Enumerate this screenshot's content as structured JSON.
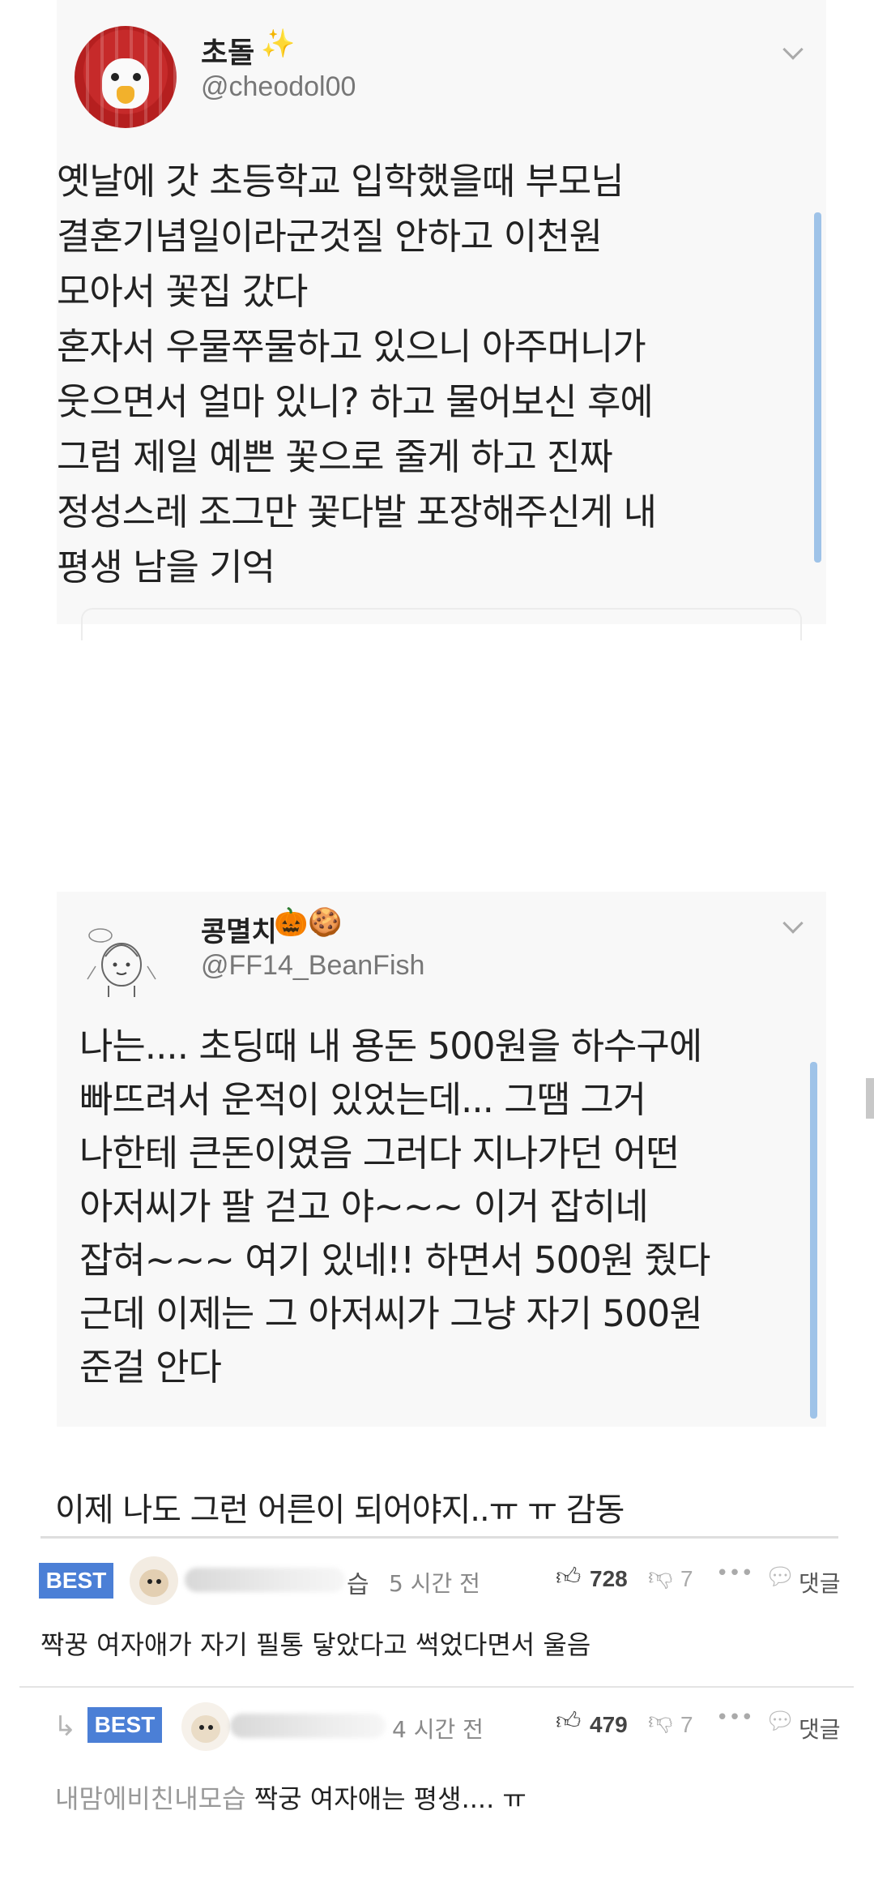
{
  "tweets": [
    {
      "name": "초돌",
      "emoji": "✨",
      "handle": "@cheodol00",
      "text": "옛날에 갓 초등학교 입학했을때 부모님\n결혼기념일이라군것질 안하고 이천원\n모아서 꽃집 갔다\n혼자서 우물쭈물하고 있으니 아주머니가\n웃으면서 얼마 있니? 하고 물어보신 후에\n그럼 제일 예쁜 꽃으로 줄게 하고 진짜\n정성스레 조그만 꽃다발 포장해주신게 내\n평생 남을 기억"
    },
    {
      "name": "콩멸치",
      "emoji": "🎃🍪",
      "handle": "@FF14_BeanFish",
      "text": "나는.... 초딩때 내 용돈 500원을 하수구에\n빠뜨려서 운적이 있었는데... 그땜 그거\n나한테 큰돈이였음 그러다 지나가던 어떤\n아저씨가 팔 걷고 야~~~ 이거 잡히네\n잡혀~~~ 여기 있네!! 하면서 500원 줬다\n근데 이제는 그 아저씨가 그냥 자기 500원\n준걸 안다"
    }
  ],
  "post_caption": "이제 나도 그런 어른이 되어야지..ㅠ ㅠ 감동",
  "comments": [
    {
      "badge": "BEST",
      "name_visible": "습",
      "time": "5 시간 전",
      "likes": "728",
      "dislikes": "7",
      "more": "•••",
      "reply_label": "댓글",
      "body": "짝꿍 여자애가 자기 필통 닿았다고 썩었다면서 울음"
    },
    {
      "badge": "BEST",
      "name_visible": "",
      "time": "4 시간 전",
      "likes": "479",
      "dislikes": "7",
      "more": "•••",
      "reply_label": "댓글",
      "mention": "내맘에비친내모습",
      "body": "짝궁 여자애는 평생.... ㅠ"
    }
  ],
  "icons": {
    "like": "thumbs-up-icon",
    "dislike": "thumbs-down-icon",
    "more": "more-icon",
    "reply": "speech-bubble-icon",
    "reply_arrow": "reply-arrow-icon",
    "chevron": "chevron-down-icon"
  },
  "colors": {
    "best_badge": "#4b7fd6",
    "tweet_accent": "#9fc3e8"
  }
}
